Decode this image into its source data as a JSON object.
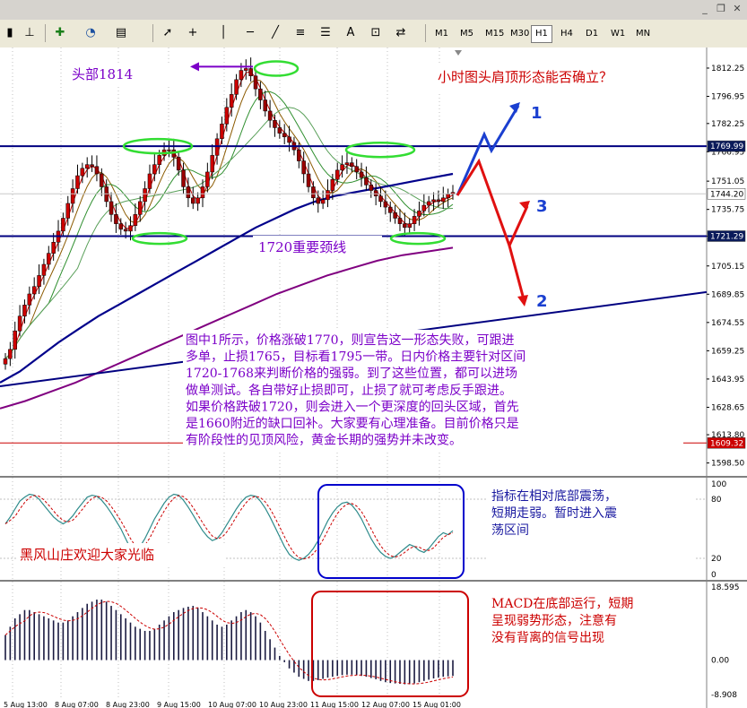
{
  "toolbar": {
    "timeframes": [
      {
        "label": "M1",
        "active": false
      },
      {
        "label": "M5",
        "active": false
      },
      {
        "label": "M15",
        "active": false
      },
      {
        "label": "M30",
        "active": false
      },
      {
        "label": "H1",
        "active": true
      },
      {
        "label": "H4",
        "active": false
      },
      {
        "label": "D1",
        "active": false
      },
      {
        "label": "W1",
        "active": false
      },
      {
        "label": "MN",
        "active": false
      }
    ],
    "tool_icons": [
      "chart-type-icon",
      "add-indicator-icon",
      "clock-icon",
      "template-icon",
      "cursor-icon",
      "crosshair-icon",
      "vertical-line-icon",
      "horizontal-line-icon",
      "trendline-icon",
      "fibonacci-icon",
      "channel-icon",
      "text-icon",
      "text-label-icon",
      "arrows-icon"
    ],
    "text_tool_label": "A",
    "window_buttons": [
      "_",
      "❐",
      "✕"
    ]
  },
  "colors": {
    "candle_up": "#cc0000",
    "candle_down": "#990000",
    "ma_fast": "#cc0000",
    "ma_mid": "#8b5a00",
    "ma_slow": "#2f8f2f",
    "ma_blue": "#00008b",
    "ma_purple": "#800080",
    "level_line": "#000080",
    "green_ellipse": "#33dd33",
    "annotation_purple": "#7b00c8",
    "blue_box": "#0000cc",
    "red_box": "#cc0000",
    "support_line": "#cc0000"
  },
  "annotations": {
    "head_label": "头部1814",
    "question": "小时图头肩顶形态能否确立？",
    "neckline_label": "1720重要颈线",
    "main_text": [
      "图中1所示，价格涨破1770，则宣告这一形态失败，可跟进",
      "多单，止损1765，目标看1795一带。日内价格主要针对区间",
      "1720-1768来判断价格的强弱。到了这些位置，都可以进场",
      "做单测试。各自带好止损即可，止损了就可考虑反手跟进。",
      "如果价格跌破1720，则会进入一个更深度的回头区域，首先",
      "是1660附近的缺口回补。大家要有心理准备。目前价格只是",
      "有阶段性的见顶风险，黄金长期的强势并未改变。"
    ],
    "stoch_text": [
      "指标在相对底部震荡，",
      "短期走弱。暂时进入震",
      "荡区间"
    ],
    "macd_text": [
      "MACD在底部运行，短期",
      "呈现弱势形态，注意有",
      "没有背离的信号出现"
    ],
    "watermark": "黑风山庄欢迎大家光临",
    "scenario_labels": [
      "1",
      "2",
      "3"
    ]
  },
  "chart_data": {
    "type": "candlestick",
    "title": "",
    "price_axis": {
      "ticks": [
        "1812.25",
        "1796.95",
        "1782.25",
        "1766.95",
        "1751.05",
        "1735.75",
        "1721.29",
        "1705.15",
        "1689.85",
        "1674.55",
        "1659.25",
        "1643.95",
        "1628.65",
        "1613.80",
        "1598.50"
      ],
      "markers": [
        {
          "value": "1769.99",
          "style": "dark"
        },
        {
          "value": "1744.20",
          "style": "light"
        },
        {
          "value": "1721.29",
          "style": "dark"
        },
        {
          "value": "1609.32",
          "style": "red"
        }
      ]
    },
    "stoch_axis": {
      "ticks": [
        "100",
        "80",
        "20",
        "0"
      ]
    },
    "macd_axis": {
      "ticks": [
        "18.595",
        "0.00",
        "-8.908"
      ]
    },
    "time_labels": [
      "5 Aug 13:00",
      "8 Aug 07:00",
      "8 Aug 23:00",
      "9 Aug 15:00",
      "10 Aug 07:00",
      "10 Aug 23:00",
      "11 Aug 15:00",
      "12 Aug 07:00",
      "15 Aug 01:00"
    ],
    "horizontal_levels": [
      1769.99,
      1721.29
    ],
    "scenario_targets": {
      "1": 1795,
      "2": 1690,
      "3": 1745
    },
    "price_path": [
      1655,
      1660,
      1670,
      1678,
      1684,
      1690,
      1694,
      1700,
      1706,
      1712,
      1718,
      1724,
      1731,
      1739,
      1747,
      1754,
      1758,
      1760,
      1759,
      1755,
      1748,
      1740,
      1733,
      1728,
      1725,
      1724,
      1727,
      1733,
      1740,
      1747,
      1755,
      1760,
      1765,
      1768,
      1768,
      1764,
      1757,
      1748,
      1742,
      1739,
      1742,
      1748,
      1756,
      1765,
      1774,
      1782,
      1791,
      1798,
      1806,
      1811,
      1812,
      1808,
      1801,
      1795,
      1789,
      1784,
      1780,
      1777,
      1775,
      1772,
      1768,
      1762,
      1755,
      1748,
      1742,
      1739,
      1741,
      1746,
      1752,
      1757,
      1760,
      1761,
      1759,
      1756,
      1753,
      1749,
      1746,
      1743,
      1740,
      1737,
      1734,
      1731,
      1728,
      1726,
      1728,
      1732,
      1735,
      1738,
      1740,
      1741,
      1740,
      1742,
      1744,
      1745
    ],
    "stoch_path": [
      55,
      62,
      70,
      78,
      82,
      85,
      84,
      80,
      74,
      68,
      62,
      58,
      55,
      58,
      63,
      70,
      76,
      82,
      84,
      83,
      79,
      73,
      66,
      58,
      50,
      40,
      30,
      28,
      32,
      40,
      50,
      60,
      68,
      76,
      82,
      85,
      84,
      79,
      72,
      64,
      56,
      48,
      42,
      38,
      40,
      46,
      54,
      62,
      70,
      77,
      82,
      84,
      83,
      78,
      71,
      62,
      52,
      42,
      32,
      24,
      20,
      18,
      20,
      24,
      30,
      38,
      48,
      58,
      66,
      72,
      76,
      77,
      74,
      68,
      60,
      50,
      40,
      32,
      26,
      22,
      20,
      22,
      26,
      30,
      34,
      32,
      28,
      26,
      30,
      36,
      42,
      46,
      44,
      48
    ],
    "macd_path": [
      6,
      8,
      10,
      11,
      12,
      12,
      11.5,
      11,
      10.5,
      10,
      9.5,
      9,
      9,
      9.5,
      10.5,
      11.5,
      12.5,
      13.5,
      14,
      14.5,
      14.5,
      14,
      13,
      12,
      11,
      10,
      9,
      8,
      7.5,
      7,
      7,
      7.5,
      8.5,
      9.5,
      10.5,
      11.5,
      12,
      12.5,
      12.8,
      13,
      12.5,
      11.5,
      10.5,
      9.5,
      8.5,
      8,
      8.5,
      9.5,
      10.5,
      11.5,
      12,
      11.5,
      10.5,
      9,
      7,
      5,
      3,
      1,
      -0.5,
      -2,
      -3,
      -4,
      -4.5,
      -5,
      -5,
      -4.8,
      -4.5,
      -4.2,
      -4,
      -3.8,
      -3.6,
      -3.5,
      -3.5,
      -3.6,
      -3.8,
      -4,
      -4.3,
      -4.6,
      -5,
      -5.3,
      -5.5,
      -5.6,
      -5.7,
      -5.8,
      -5.8,
      -5.6,
      -5.3,
      -5,
      -4.7,
      -4.4,
      -4.2,
      -4,
      -3.9,
      -3.8
    ]
  }
}
